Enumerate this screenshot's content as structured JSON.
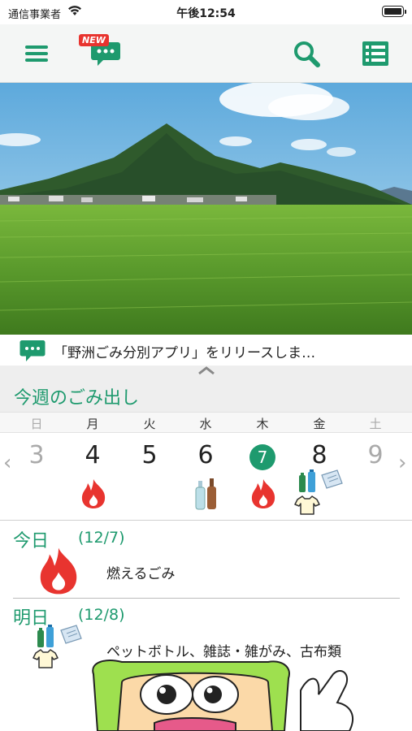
{
  "status": {
    "carrier": "通信事業者",
    "time": "午後12:54"
  },
  "toolbar": {
    "new_badge": "NEW"
  },
  "news": {
    "text": "「野洲ごみ分別アプリ」をリリースしま…"
  },
  "week": {
    "title": "今週のごみ出し",
    "days": [
      "日",
      "月",
      "火",
      "水",
      "木",
      "金",
      "土"
    ],
    "dates": [
      "3",
      "4",
      "5",
      "6",
      "7",
      "8",
      "9"
    ],
    "today_date": "7"
  },
  "today": {
    "label": "今日",
    "date": "(12/7)",
    "desc": "燃えるごみ"
  },
  "tomorrow": {
    "label": "明日",
    "date": "(12/8)",
    "desc": "ペットボトル、雑誌・雑がみ、古布類"
  },
  "colors": {
    "accent": "#1e9a6e",
    "fire": "#e8342f"
  }
}
